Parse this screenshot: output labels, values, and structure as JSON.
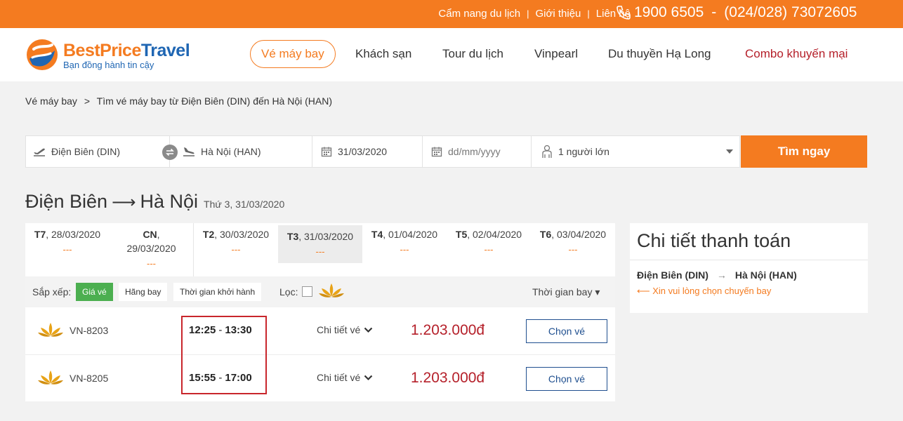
{
  "topbar": {
    "links": [
      "Cẩm nang du lịch",
      "Giới thiệu",
      "Liên hệ"
    ],
    "separator": "|",
    "phone_1": "1900 6505",
    "phone_dash": "-",
    "phone_2": "(024/028) 73072605"
  },
  "logo": {
    "brand_a": "BestPrice",
    "brand_b": "Travel",
    "tagline": "Bạn đồng hành tin cậy"
  },
  "nav": [
    {
      "label": "Vé máy bay"
    },
    {
      "label": "Khách sạn"
    },
    {
      "label": "Tour du lịch"
    },
    {
      "label": "Vinpearl"
    },
    {
      "label": "Du thuyền Hạ Long"
    },
    {
      "label": "Combo khuyến mại"
    }
  ],
  "breadcrumb": {
    "home": "Vé máy bay",
    "arrow": ">",
    "current": "Tìm vé máy bay từ Điện Biên (DIN) đến Hà Nội (HAN)"
  },
  "search": {
    "from": "Điện Biên (DIN)",
    "to": "Hà Nội (HAN)",
    "depart_date": "31/03/2020",
    "return_placeholder": "dd/mm/yyyy",
    "passengers": "1 người lớn",
    "button": "Tìm ngay"
  },
  "route": {
    "from": "Điện Biên",
    "arrow": "⟶",
    "to": "Hà Nội",
    "date": "Thứ 3, 31/03/2020"
  },
  "date_tabs": [
    {
      "day": "T7",
      "date": ", 28/03/2020",
      "price": "---"
    },
    {
      "day": "CN",
      "date": ",",
      "date2": "29/03/2020",
      "price": "---"
    },
    {
      "day": "T2",
      "date": ", 30/03/2020",
      "price": "---"
    },
    {
      "day": "T3",
      "date": ", 31/03/2020",
      "price": "---"
    },
    {
      "day": "T4",
      "date": ", 01/04/2020",
      "price": "---"
    },
    {
      "day": "T5",
      "date": ", 02/04/2020",
      "price": "---"
    },
    {
      "day": "T6",
      "date": ", 03/04/2020",
      "price": "---"
    }
  ],
  "sort": {
    "label": "Sắp xếp:",
    "by_price": "Giá vé",
    "by_airline": "Hãng bay",
    "by_time": "Thời gian khởi hành",
    "filter_label": "Lọc:",
    "flight_time": "Thời gian bay",
    "caret": "▾"
  },
  "flights": [
    {
      "code": "VN-8203",
      "depart": "12:25",
      "dash": "-",
      "arrive": "13:30",
      "detail": "Chi tiết vé",
      "price": "1.203.000đ",
      "button": "Chọn vé"
    },
    {
      "code": "VN-8205",
      "depart": "15:55",
      "dash": "-",
      "arrive": "17:00",
      "detail": "Chi tiết vé",
      "price": "1.203.000đ",
      "button": "Chọn vé"
    }
  ],
  "payment": {
    "title": "Chi tiết thanh toán",
    "from": "Điện Biên (DIN)",
    "arrow": "→",
    "to": "Hà Nội (HAN)",
    "note": "⟵ Xin vui lòng chọn chuyến bay"
  },
  "colors": {
    "brand_orange": "#f47b20",
    "brand_blue": "#1f66b3",
    "price_red": "#b5202a",
    "sort_green": "#4caf50",
    "highlight_red": "#c8262c"
  }
}
